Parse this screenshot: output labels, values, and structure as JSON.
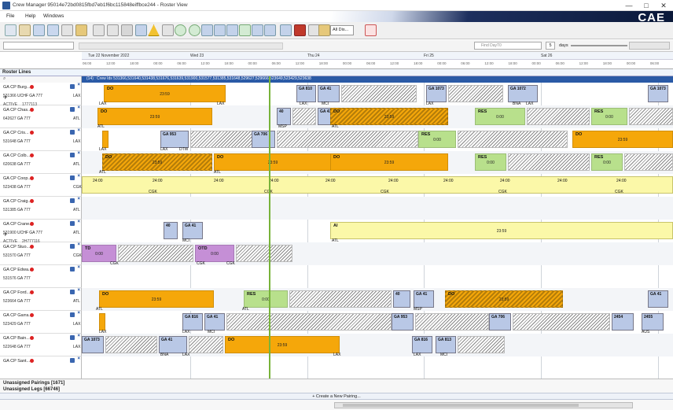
{
  "titlebar": {
    "title": "Crew Manager 95014e72bd0815fbd7eb1f6bc115848eiffbce244 - Roster View",
    "minimize": "—",
    "maximize": "□",
    "close": "✕"
  },
  "menu": [
    "File",
    "Help",
    "Windows"
  ],
  "brand": "CAE",
  "toolbar": {
    "dropdown": "All Dis..."
  },
  "filterbar": {
    "search_placeholder": "Find DayT0",
    "days_value": "5",
    "days_label": "days"
  },
  "timeline": {
    "days": [
      "Tue 22 November 2022",
      "Wed 23",
      "Thu 24",
      "Fri 25",
      "Sat 26"
    ],
    "hours": [
      "06:00",
      "12:00",
      "18:00",
      "00:00",
      "06:00",
      "12:00",
      "18:00",
      "00:00",
      "06:00",
      "12:00",
      "18:00",
      "00:00",
      "06:00",
      "12:00",
      "18:00",
      "00:00",
      "06:00",
      "12:00",
      "18:00",
      "00:00",
      "06:00",
      "12:00",
      "18:00",
      "00:00",
      "06:00"
    ]
  },
  "section": {
    "roster_lines": "Roster Lines",
    "data_row": "(14) : Crew Ids 531366,531640,531438,531676,531639,531900,531577,531385,531648,529627,529666,523649,523429,523638"
  },
  "crew": [
    {
      "name": "GA CP Burg...",
      "id": "531366",
      "sub": "GA 777",
      "sub2": "UCHF",
      "base": "LAX",
      "status": "ACTIVE",
      "status2": "1777113",
      "plane": true
    },
    {
      "name": "GA CP Chas...",
      "id": "642627",
      "sub": "GA 777",
      "sub2": "",
      "base": "ATL",
      "status": "",
      "status2": "",
      "plane": false
    },
    {
      "name": "GA CP Cris...",
      "id": "531648",
      "sub": "GA 777",
      "sub2": "",
      "base": "LAX",
      "status": "",
      "status2": "",
      "plane": false
    },
    {
      "name": "GA CP Colb...",
      "id": "620638",
      "sub": "GA 777",
      "sub2": "",
      "base": "ATL",
      "status": "",
      "status2": "",
      "plane": false
    },
    {
      "name": "GA CP Coop...",
      "id": "523438",
      "sub": "GA 777",
      "sub2": "",
      "base": "CGK",
      "status": "",
      "status2": "",
      "plane": false
    },
    {
      "name": "GA CP Craig...",
      "id": "531385",
      "sub": "GA 777",
      "sub2": "",
      "base": "ATL",
      "status": "",
      "status2": "",
      "plane": false
    },
    {
      "name": "GA CP Crane...",
      "id": "531900",
      "sub": "GA 777",
      "sub2": "UCHF",
      "base": "ATL",
      "status": "ACTIVE",
      "status2": "2H777116",
      "plane": true
    },
    {
      "name": "GA CP Stuo...",
      "id": "531570",
      "sub": "GA 777",
      "sub2": "",
      "base": "CGK",
      "status": "",
      "status2": "",
      "plane": false
    },
    {
      "name": "GA CP Edwa...",
      "id": "531576",
      "sub": "GA 777",
      "sub2": "",
      "base": "",
      "status": "",
      "status2": "",
      "plane": false
    },
    {
      "name": "GA CP Ford...",
      "id": "523664",
      "sub": "GA 777",
      "sub2": "",
      "base": "ATL",
      "status": "",
      "status2": "",
      "plane": false
    },
    {
      "name": "GA CP Garra...",
      "id": "523429",
      "sub": "GA 777",
      "sub2": "",
      "base": "LAX",
      "status": "",
      "status2": "",
      "plane": false
    },
    {
      "name": "GA CP Bain...",
      "id": "522648",
      "sub": "GA 777",
      "sub2": "",
      "base": "LAX",
      "status": "",
      "status2": "",
      "plane": false
    },
    {
      "name": "GA CP Sant...",
      "id": "",
      "sub": "",
      "sub2": "",
      "base": "",
      "status": "",
      "status2": "",
      "plane": false
    }
  ],
  "activities": {
    "do_label": "DO",
    "res_label": "RES",
    "ai_label": "AI",
    "td_label": "TD",
    "otd_label": "OTD",
    "time_2359": "23:59",
    "time_0000": "0:00",
    "time_2400": "24:00",
    "flights": [
      "GA 810",
      "GA 41",
      "GA 813",
      "GA 1073",
      "GA 1072",
      "GA 41",
      "40",
      "GA 41",
      "GA 953",
      "GA 706",
      "GA 41",
      "GA 953",
      "GA 706",
      "GA 816",
      "GA 813",
      "2454",
      "2455",
      "GA 1073"
    ]
  },
  "stations": {
    "lax": "LAX",
    "atl": "ATL",
    "mci": "MCI",
    "bna": "BNA",
    "msp": "MSP",
    "dtw": "DTW",
    "cgk": "CGK",
    "aus": "AUS"
  },
  "bottom": {
    "unassigned_pairings": "Unassigned Pairings [1671]",
    "unassigned_legs": "Unassigned Legs [66746]",
    "create_pairing": "+ Create a New Pairing..."
  }
}
